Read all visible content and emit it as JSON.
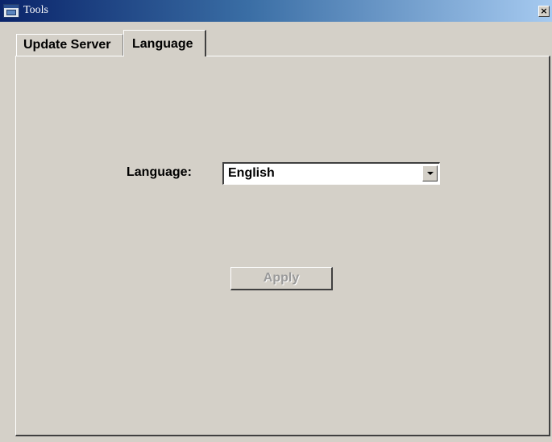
{
  "window": {
    "title": "Tools",
    "close_glyph": "×",
    "app_icon": "tools-app-icon",
    "close_icon": "close-icon"
  },
  "tabs": [
    {
      "label": "Update Server",
      "selected": false
    },
    {
      "label": "Language",
      "selected": true
    }
  ],
  "language_panel": {
    "language_label": "Language:",
    "language_select": {
      "value": "English",
      "arrow_icon": "chevron-down-icon"
    },
    "apply_button": {
      "label": "Apply",
      "enabled": false
    }
  },
  "colors": {
    "title_gradient_start": "#0a246a",
    "title_gradient_end": "#a6caf0",
    "face": "#d4d0c8",
    "disabled_text": "#9a9a9a"
  }
}
